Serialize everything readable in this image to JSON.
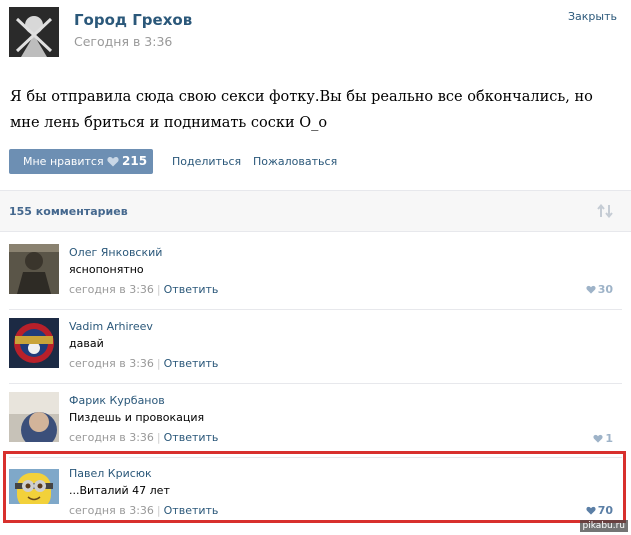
{
  "post": {
    "group_name": "Город Грехов",
    "time": "Сегодня в 3:36",
    "close_label": "Закрыть",
    "text": "Я бы отправила сюда свою секси фотку.Вы бы реально все обкончались, но мне лень бриться и поднимать соски О_о",
    "like_label": "Мне нравится",
    "like_count": "215",
    "share_label": "Поделиться",
    "report_label": "Пожаловаться"
  },
  "comments_header": {
    "count_label": "155 комментариев"
  },
  "comments": [
    {
      "author": "Олег Янковский",
      "text": "яснопонятно",
      "time": "сегодня в 3:36",
      "reply_label": "Ответить",
      "likes": "30"
    },
    {
      "author": "Vadim Arhireev",
      "text": "давай",
      "time": "сегодня в 3:36",
      "reply_label": "Ответить",
      "likes": ""
    },
    {
      "author": "Фарик Курбанов",
      "text": "Пиздешь и провокация",
      "time": "сегодня в 3:36",
      "reply_label": "Ответить",
      "likes": "1"
    },
    {
      "author": "Павел Крисюк",
      "text": "...Виталий 47 лет",
      "time": "сегодня в 3:36",
      "reply_label": "Ответить",
      "likes": "70"
    }
  ],
  "watermark": "pikabu.ru",
  "colors": {
    "link": "#2b587a",
    "button": "#6d8fb3",
    "highlight": "#d8302d",
    "like_heart": "#9eb3c8"
  }
}
